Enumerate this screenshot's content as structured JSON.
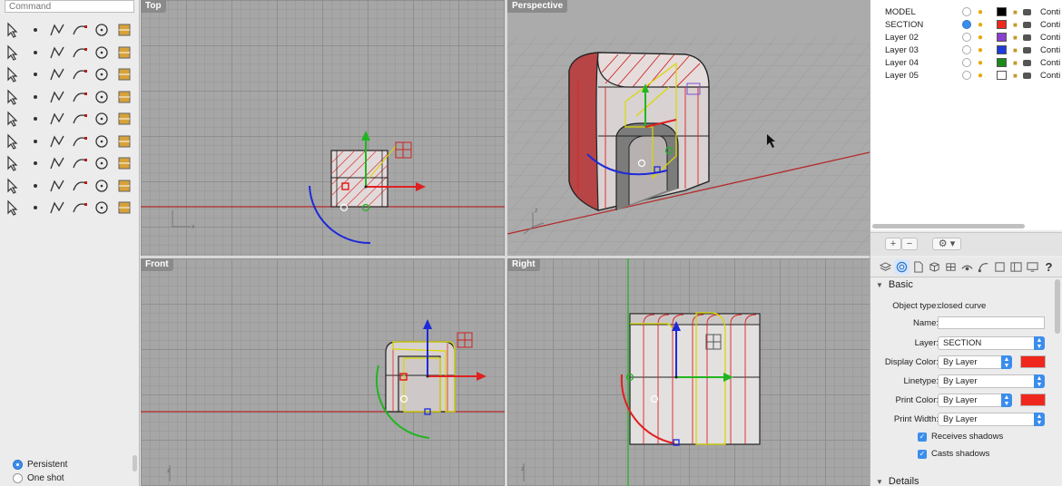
{
  "command": {
    "placeholder": "Command"
  },
  "tools": [
    "select-arrow-icon",
    "point-icon",
    "polyline-icon",
    "curve-icon",
    "circle-icon",
    "arc-icon",
    "rectangle-icon",
    "rectangle-rotated-icon",
    "fillet-curve-icon",
    "freeform-curve-icon",
    "edit-points-icon",
    "bucket-icon",
    "box-solid-icon",
    "sphere-solid-icon",
    "cylinder-solid-icon",
    "surface-plane-icon",
    "explode-icon",
    "patch-icon",
    "split-icon",
    "trim-icon",
    "boolean-icon",
    "points-cloud-icon",
    "rotate-icon",
    "move-curve-icon",
    "text-icon",
    "scale-icon",
    "array-icon",
    "flow-icon",
    "shade-icon",
    "blank-icon",
    "grid-array-icon",
    "hammer-icon",
    "layer-edit-icon",
    "check-icon",
    "paint-bucket-icon",
    "blank2-icon",
    "zoom-icon",
    "zoom-window-icon",
    "zoom-extents-icon",
    "zoom-selected-icon",
    "car-icon",
    "car-red-icon",
    "mesh-icon",
    "group-icon",
    "bulb-icon",
    "lock-icon",
    "render-icon",
    "color-wheel-icon",
    "globe-icon",
    "globe-wire-icon",
    "globe-shade-icon",
    "dimension-icon",
    "blank3-icon",
    "blank4-icon"
  ],
  "osnap": {
    "persistent": "Persistent",
    "one_shot": "One shot"
  },
  "viewports": {
    "top": "Top",
    "perspective": "Perspective",
    "front": "Front",
    "right": "Right"
  },
  "layers": [
    {
      "name": "MODEL",
      "current": false,
      "color": "#000000",
      "linetype": "Conti"
    },
    {
      "name": "SECTION",
      "current": true,
      "color": "#f0271c",
      "linetype": "Conti"
    },
    {
      "name": "Layer 02",
      "current": false,
      "color": "#8a3fd1",
      "linetype": "Conti"
    },
    {
      "name": "Layer 03",
      "current": false,
      "color": "#1f3bd9",
      "linetype": "Conti"
    },
    {
      "name": "Layer 04",
      "current": false,
      "color": "#1b8a1b",
      "linetype": "Conti"
    },
    {
      "name": "Layer 05",
      "current": false,
      "color": "#ffffff",
      "linetype": "Conti"
    }
  ],
  "layers_toolbar": {
    "add": "+",
    "remove": "−",
    "gear": "⚙"
  },
  "properties": {
    "section_basic": "Basic",
    "section_details": "Details",
    "object_type_label": "Object type:",
    "object_type_value": "closed curve",
    "name_label": "Name:",
    "name_value": "",
    "layer_label": "Layer:",
    "layer_value": "SECTION",
    "display_color_label": "Display Color:",
    "display_color_value": "By Layer",
    "linetype_label": "Linetype:",
    "linetype_value": "By Layer",
    "print_color_label": "Print Color:",
    "print_color_value": "By Layer",
    "print_width_label": "Print Width:",
    "print_width_value": "By Layer",
    "receives_shadows": "Receives shadows",
    "casts_shadows": "Casts shadows",
    "swatch_color": "#f0271c"
  },
  "axis_labels": {
    "x": "x",
    "y": "y",
    "z": "z"
  }
}
